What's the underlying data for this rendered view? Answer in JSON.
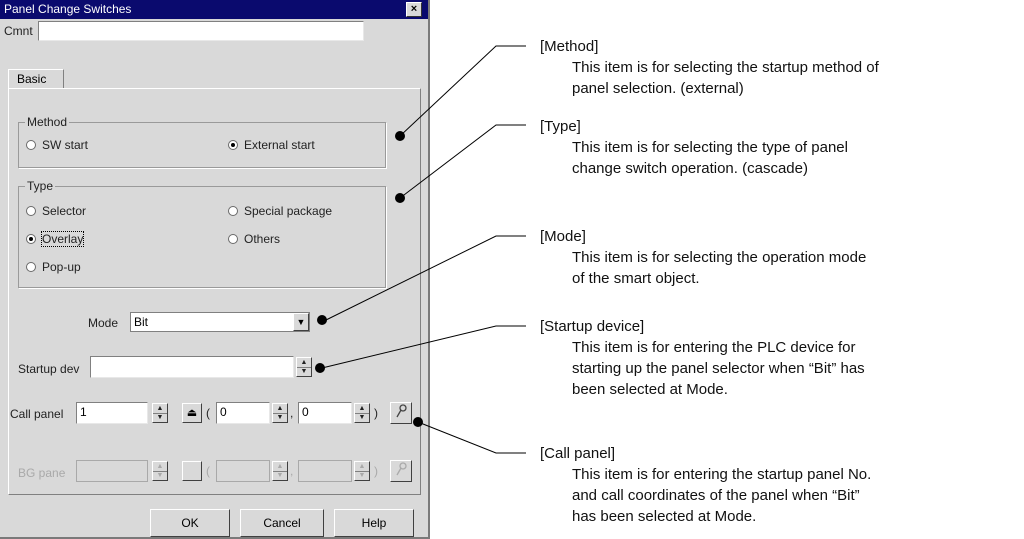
{
  "dialog": {
    "title": "Panel Change Switches",
    "close_glyph": "×",
    "comment_label": "Cmnt",
    "comment_value": "",
    "tab_basic": "Basic",
    "method": {
      "title": "Method",
      "sw_start": "SW start",
      "external_start": "External start",
      "selected": "External start"
    },
    "type": {
      "title": "Type",
      "selector": "Selector",
      "special_package": "Special package",
      "overlay": "Overlay",
      "others": "Others",
      "popup": "Pop-up",
      "selected": "Overlay"
    },
    "mode": {
      "label": "Mode",
      "value": "Bit"
    },
    "startup": {
      "label": "Startup dev",
      "value": ""
    },
    "call_panel": {
      "label": "Call panel",
      "value": "1",
      "x_value": "0",
      "y_value": "0",
      "open_paren": "(",
      "comma": ",",
      "close_paren": ")"
    },
    "bg_panel": {
      "label": "BG pane",
      "open_paren": "(",
      "comma": ",",
      "close_paren": ")"
    },
    "buttons": {
      "ok": "OK",
      "cancel": "Cancel",
      "help": "Help"
    }
  },
  "annotations": [
    {
      "heading": "[Method]",
      "lines": [
        "This item is for selecting the startup method of",
        "panel selection. (external)"
      ]
    },
    {
      "heading": "[Type]",
      "lines": [
        "This item is for selecting the type of panel",
        "change switch operation. (cascade)"
      ]
    },
    {
      "heading": "[Mode]",
      "lines": [
        "This item is for selecting the operation mode",
        "of the smart object."
      ]
    },
    {
      "heading": "[Startup device]",
      "lines": [
        "This item is for entering the PLC device for",
        "starting up the panel selector when “Bit” has",
        "been selected at Mode."
      ]
    },
    {
      "heading": "[Call panel]",
      "lines": [
        "This item is for entering the startup panel No.",
        "and call coordinates of the panel when “Bit”",
        "has been selected at Mode."
      ]
    }
  ]
}
